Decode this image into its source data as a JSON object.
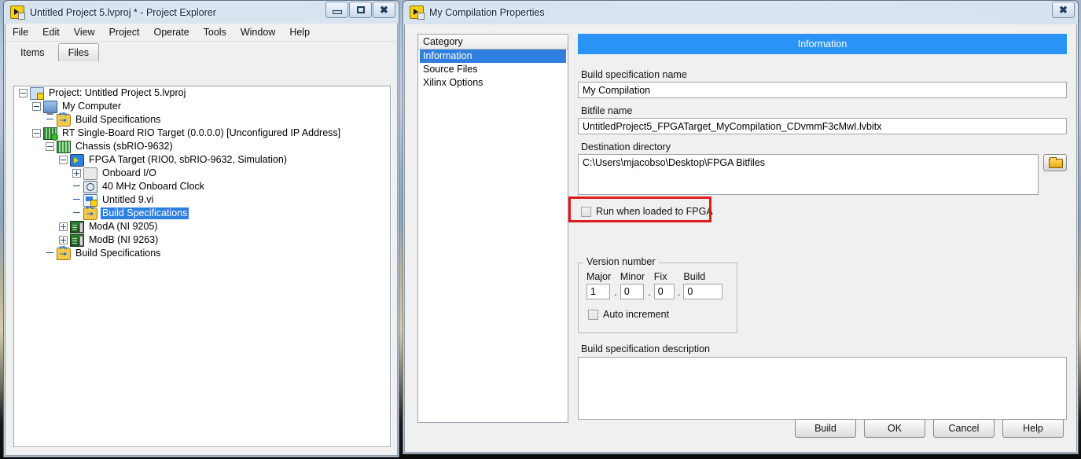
{
  "project_window": {
    "title": "Untitled Project 5.lvproj * - Project Explorer",
    "app_icon": "labview-project-icon",
    "window_controls": {
      "minimize": "minimize-icon",
      "restore": "restore-icon",
      "close": "close-icon"
    },
    "menu": [
      {
        "label": "File"
      },
      {
        "label": "Edit"
      },
      {
        "label": "View"
      },
      {
        "label": "Project"
      },
      {
        "label": "Operate"
      },
      {
        "label": "Tools"
      },
      {
        "label": "Window"
      },
      {
        "label": "Help"
      }
    ],
    "tabs": [
      {
        "label": "Items",
        "active": true
      },
      {
        "label": "Files",
        "active": false
      }
    ],
    "tree": [
      {
        "label": "Project: Untitled Project 5.lvproj",
        "depth": 0,
        "icon": "project-icon",
        "toggle": "minus",
        "selected": false
      },
      {
        "label": "My Computer",
        "depth": 1,
        "icon": "computer-icon",
        "toggle": "minus",
        "selected": false
      },
      {
        "label": "Build Specifications",
        "depth": 2,
        "icon": "build-spec-icon",
        "toggle": "none",
        "selected": false
      },
      {
        "label": "RT Single-Board RIO Target (0.0.0.0) [Unconfigured IP Address]",
        "depth": 1,
        "icon": "rt-target-icon",
        "toggle": "minus",
        "selected": false
      },
      {
        "label": "Chassis (sbRIO-9632)",
        "depth": 2,
        "icon": "chassis-icon",
        "toggle": "minus",
        "selected": false
      },
      {
        "label": "FPGA Target (RIO0, sbRIO-9632, Simulation)",
        "depth": 3,
        "icon": "fpga-target-icon",
        "toggle": "minus",
        "selected": false
      },
      {
        "label": "Onboard I/O",
        "depth": 4,
        "icon": "folder-icon",
        "toggle": "plus",
        "selected": false
      },
      {
        "label": "40 MHz Onboard Clock",
        "depth": 4,
        "icon": "clock-icon",
        "toggle": "none",
        "selected": false
      },
      {
        "label": "Untitled 9.vi",
        "depth": 4,
        "icon": "vi-icon",
        "toggle": "none",
        "selected": false
      },
      {
        "label": "Build Specifications",
        "depth": 4,
        "icon": "build-spec-icon",
        "toggle": "none",
        "selected": true
      },
      {
        "label": "ModA (NI 9205)",
        "depth": 3,
        "icon": "module-icon",
        "toggle": "plus",
        "selected": false
      },
      {
        "label": "ModB (NI 9263)",
        "depth": 3,
        "icon": "module-icon",
        "toggle": "plus",
        "selected": false
      },
      {
        "label": "Build Specifications",
        "depth": 2,
        "icon": "build-spec-icon",
        "toggle": "none",
        "selected": false
      }
    ]
  },
  "properties_dialog": {
    "title": "My Compilation Properties",
    "app_icon": "labview-project-icon",
    "close_label": "close-icon",
    "category": {
      "header": "Category",
      "items": [
        {
          "label": "Information",
          "selected": true
        },
        {
          "label": "Source Files",
          "selected": false
        },
        {
          "label": "Xilinx Options",
          "selected": false
        }
      ]
    },
    "section_header": "Information",
    "fields": {
      "build_spec_name_label": "Build specification name",
      "build_spec_name_value": "My Compilation",
      "bitfile_name_label": "Bitfile name",
      "bitfile_name_value": "UntitledProject5_FPGATarget_MyCompilation_CDvmmF3cMwI.lvbitx",
      "destination_directory_label": "Destination directory",
      "destination_directory_value": "C:\\Users\\mjacobso\\Desktop\\FPGA Bitfiles",
      "browse_icon": "folder-open-icon",
      "run_when_loaded_label": "Run when loaded to FPGA",
      "run_when_loaded_checked": false,
      "description_label": "Build specification description",
      "description_value": ""
    },
    "version": {
      "group_title": "Version number",
      "major_label": "Major",
      "major_value": "1",
      "minor_label": "Minor",
      "minor_value": "0",
      "fix_label": "Fix",
      "fix_value": "0",
      "build_label": "Build",
      "build_value": "0",
      "separator": ".",
      "auto_increment_label": "Auto increment",
      "auto_increment_checked": false
    },
    "buttons": [
      {
        "label": "Build"
      },
      {
        "label": "OK"
      },
      {
        "label": "Cancel"
      },
      {
        "label": "Help"
      }
    ]
  },
  "annotation": {
    "highlight_color": "#e01b1b",
    "target": "run-when-loaded-to-fpga-checkbox"
  },
  "colors": {
    "selection_blue": "#2f7fe0",
    "header_blue": "#2a93f5",
    "window_bg": "#f0f0f0"
  }
}
